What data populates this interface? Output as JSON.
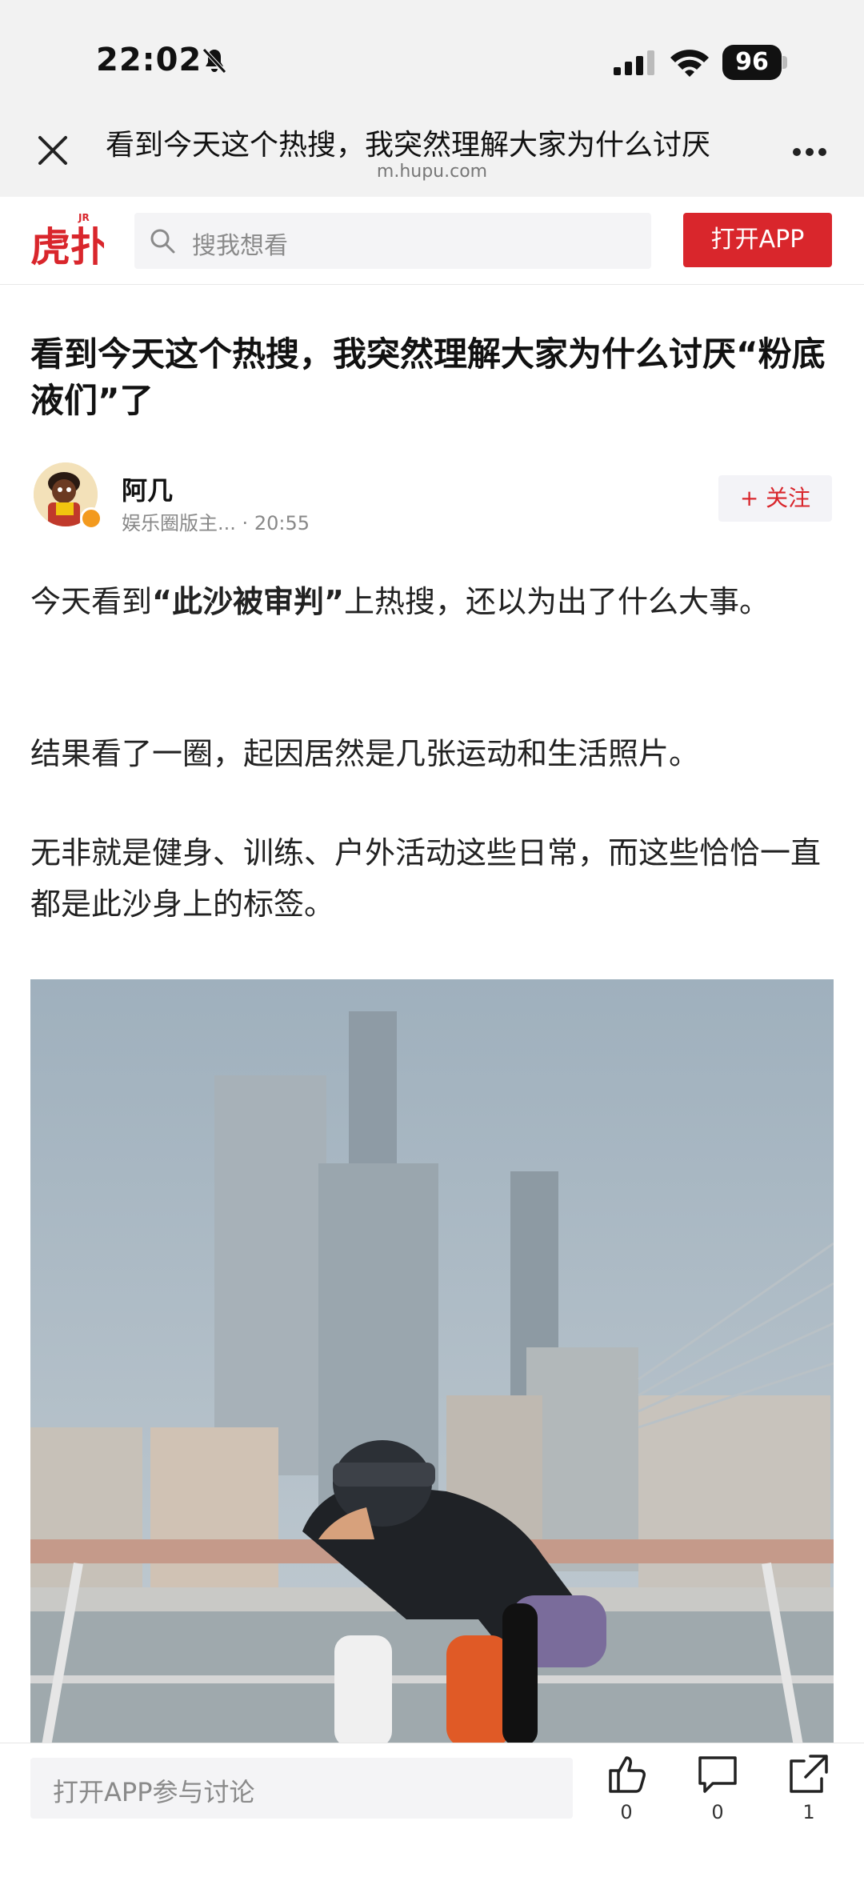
{
  "status_bar": {
    "time": "22:02",
    "battery": "96"
  },
  "browser": {
    "page_title": "看到今天这个热搜，我突然理解大家为什么讨厌",
    "domain": "m.hupu.com"
  },
  "header": {
    "logo_text": "虎扑",
    "search_placeholder": "搜我想看",
    "open_app_label": "打开APP"
  },
  "article": {
    "title": "看到今天这个热搜，我突然理解大家为什么讨厌“粉底液们”了",
    "author": {
      "name": "阿几",
      "role": "娱乐圈版主...",
      "separator": "·",
      "time": "20:55"
    },
    "follow_label": "+ 关注",
    "paragraphs": {
      "p1_before": "今天看到",
      "p1_bold": "“此沙被审判”",
      "p1_after": "上热搜，还以为出了什么大事。",
      "p2": "结果看了一圈，起因居然是几张运动和生活照片。",
      "p3": "无非就是健身、训练、户外活动这些日常，而这些恰恰一直都是此沙身上的标签。"
    }
  },
  "bottom_bar": {
    "comment_placeholder": "打开APP参与讨论",
    "like_count": "0",
    "comment_count": "0",
    "share_count": "1"
  },
  "colors": {
    "brand_red": "#d9262c",
    "chrome_bg": "#f2f2f2"
  },
  "icons": [
    "bell-slash-icon",
    "signal-icon",
    "wifi-icon",
    "close-icon",
    "more-icon",
    "search-icon",
    "thumbs-up-icon",
    "comment-icon",
    "share-icon"
  ]
}
